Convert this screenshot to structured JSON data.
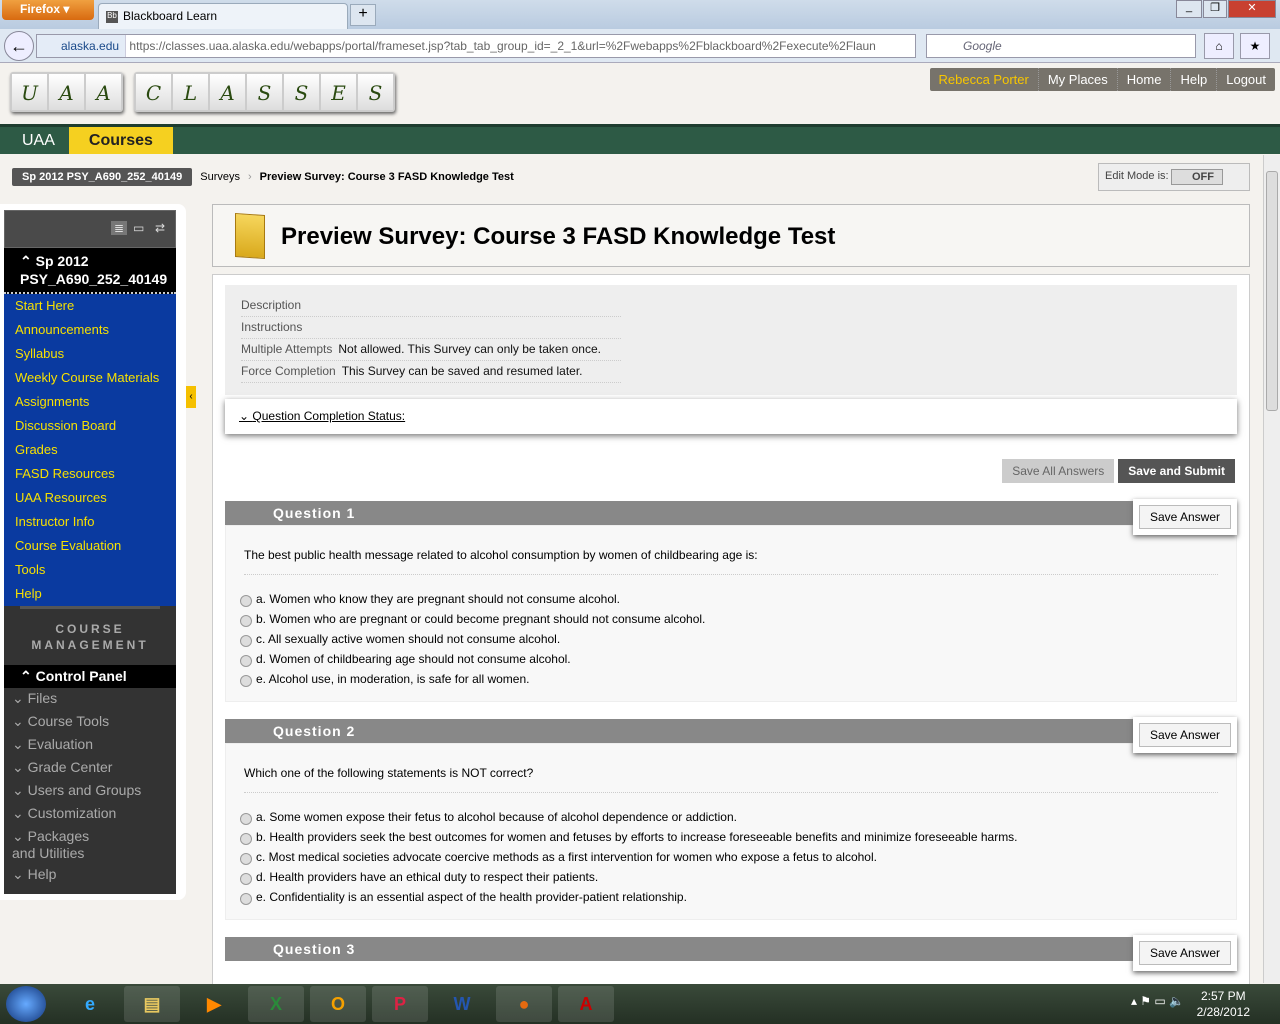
{
  "browser": {
    "menu_label": "Firefox",
    "tab_title": "Blackboard Learn",
    "tab_favicon": "Bb",
    "new_tab": "+",
    "site_identity": "alaska.edu",
    "url": "https://classes.uaa.alaska.edu/webapps/portal/frameset.jsp?tab_tab_group_id=_2_1&url=%2Fwebapps%2Fblackboard%2Fexecute%2Flaun",
    "search_placeholder": "Google"
  },
  "logo": {
    "letters1": [
      "U",
      "A",
      "A"
    ],
    "letters2": [
      "C",
      "L",
      "A",
      "S",
      "S",
      "E",
      "S"
    ]
  },
  "user_nav": {
    "user": "Rebecca Porter",
    "items": [
      "My Places",
      "Home",
      "Help",
      "Logout"
    ]
  },
  "tabs": [
    {
      "label": "UAA"
    },
    {
      "label": "Courses"
    }
  ],
  "breadcrumb": {
    "course": "Sp 2012 PSY_A690_252_40149",
    "items": [
      "Surveys",
      "Preview Survey: Course 3 FASD Knowledge Test"
    ]
  },
  "edit_mode": {
    "label": "Edit Mode is:",
    "value": "OFF"
  },
  "sidebar": {
    "course_title_line1": "Sp 2012",
    "course_title_line2": "PSY_A690_252_40149",
    "menu": [
      "Start Here",
      "Announcements",
      "Syllabus",
      "Weekly Course Materials",
      "Assignments",
      "Discussion Board",
      "Grades",
      "FASD Resources",
      "UAA Resources",
      "Instructor Info",
      "Course Evaluation",
      "Tools",
      "Help"
    ],
    "course_management": "COURSE MANAGEMENT",
    "control_panel": "Control Panel",
    "cm_items": [
      "Files",
      "Course Tools",
      "Evaluation",
      "Grade Center",
      "Users and Groups",
      "Customization",
      "Packages and Utilities",
      "Help"
    ]
  },
  "page": {
    "title": "Preview Survey: Course 3 FASD Knowledge Test",
    "details": [
      {
        "label": "Description",
        "value": ""
      },
      {
        "label": "Instructions",
        "value": ""
      },
      {
        "label": "Multiple Attempts",
        "value": "Not allowed. This Survey can only be taken once."
      },
      {
        "label": "Force Completion",
        "value": "This Survey can be saved and resumed later."
      }
    ],
    "completion_status": "Question Completion Status:",
    "save_all": "Save All Answers",
    "save_submit": "Save and Submit",
    "save_answer": "Save Answer",
    "questions": [
      {
        "title": "Question 1",
        "text": "The best public health message related to alcohol consumption by women of childbearing age is:",
        "options": [
          "a. Women who know they are pregnant should not consume alcohol.",
          "b. Women who are pregnant or could become pregnant should not consume alcohol.",
          "c. All sexually active women should not consume alcohol.",
          "d. Women of childbearing age should not consume alcohol.",
          "e. Alcohol use, in moderation, is safe for all women."
        ]
      },
      {
        "title": "Question 2",
        "text": "Which one of the following statements is NOT correct?",
        "options": [
          "a. Some women expose their fetus to alcohol because of alcohol dependence or addiction.",
          "b. Health providers seek the best outcomes for women and fetuses by efforts to increase foreseeable benefits and minimize foreseeable harms.",
          "c. Most medical societies advocate coercive methods as a first intervention for women who expose a fetus to alcohol.",
          "d. Health providers have an ethical duty to respect their patients.",
          "e. Confidentiality is an essential aspect of the health provider-patient relationship."
        ]
      },
      {
        "title": "Question 3",
        "text": "",
        "options": []
      }
    ]
  },
  "taskbar": {
    "time": "2:57 PM",
    "date": "2/28/2012",
    "apps": [
      "internet-explorer",
      "windows-explorer",
      "media-player",
      "excel",
      "outlook",
      "powerpoint",
      "word",
      "firefox",
      "acrobat"
    ]
  }
}
